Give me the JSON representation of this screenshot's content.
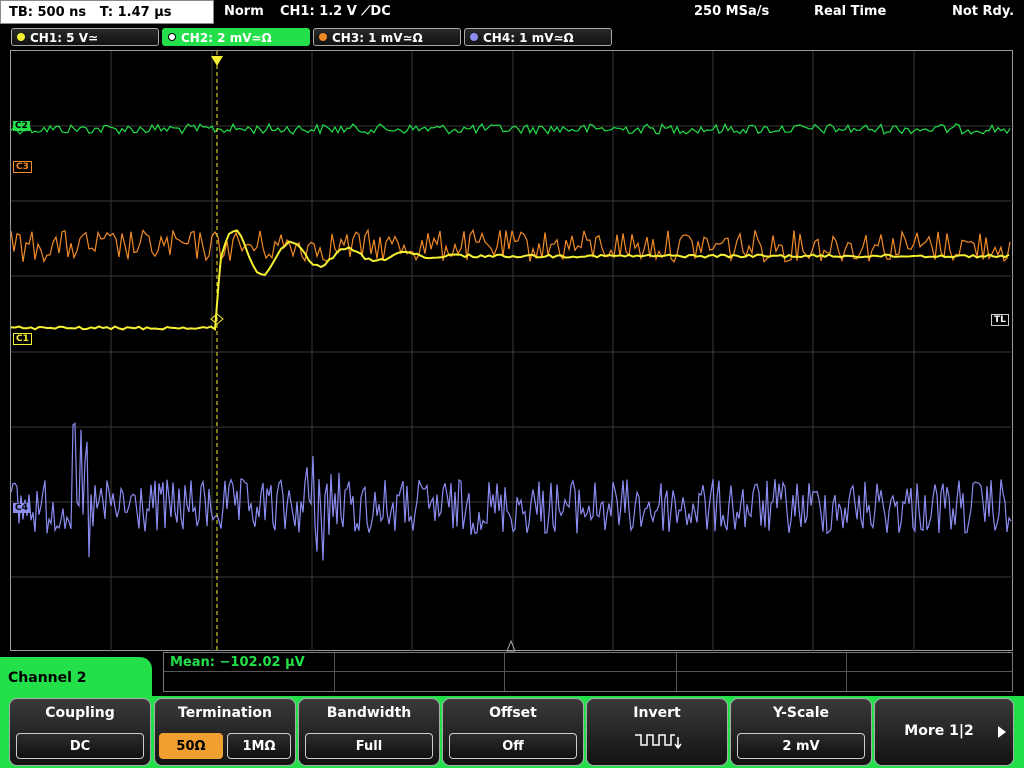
{
  "topbar": {
    "timebase": "TB: 500 ns",
    "trigger_time": "T: 1.47 µs",
    "mode": "Norm",
    "trigger": "CH1: 1.2 V ⟋DC",
    "sample_rate": "250 MSa/s",
    "acq_mode": "Real Time",
    "status": "Not Rdy."
  },
  "channels": [
    {
      "label": "CH1: 5 V≃",
      "color": "#f5f032"
    },
    {
      "label": "CH2: 2 mV≃Ω",
      "color": "#23e04a"
    },
    {
      "label": "CH3: 1 mV≃Ω",
      "color": "#f08a28"
    },
    {
      "label": "CH4: 1 mV≃Ω",
      "color": "#8a8cf0"
    }
  ],
  "markers": {
    "c2": "C2",
    "c3": "C3",
    "c1": "C1",
    "c4": "C4",
    "trigger_level": "TL",
    "trigger_pos": "T"
  },
  "measurement": "Mean: −102.02 µV",
  "menu": {
    "title": "Channel 2",
    "coupling": {
      "title": "Coupling",
      "value": "DC"
    },
    "termination": {
      "title": "Termination",
      "opt1": "50Ω",
      "opt2": "1MΩ"
    },
    "bandwidth": {
      "title": "Bandwidth",
      "value": "Full"
    },
    "offset": {
      "title": "Offset",
      "value": "Off"
    },
    "invert": {
      "title": "Invert"
    },
    "yscale": {
      "title": "Y-Scale",
      "value": "2 mV"
    },
    "more": {
      "title": "More 1|2"
    }
  },
  "icons": [
    "invert-waveform-icon",
    "next-page-arrow-icon",
    "channel-dot-icon"
  ]
}
